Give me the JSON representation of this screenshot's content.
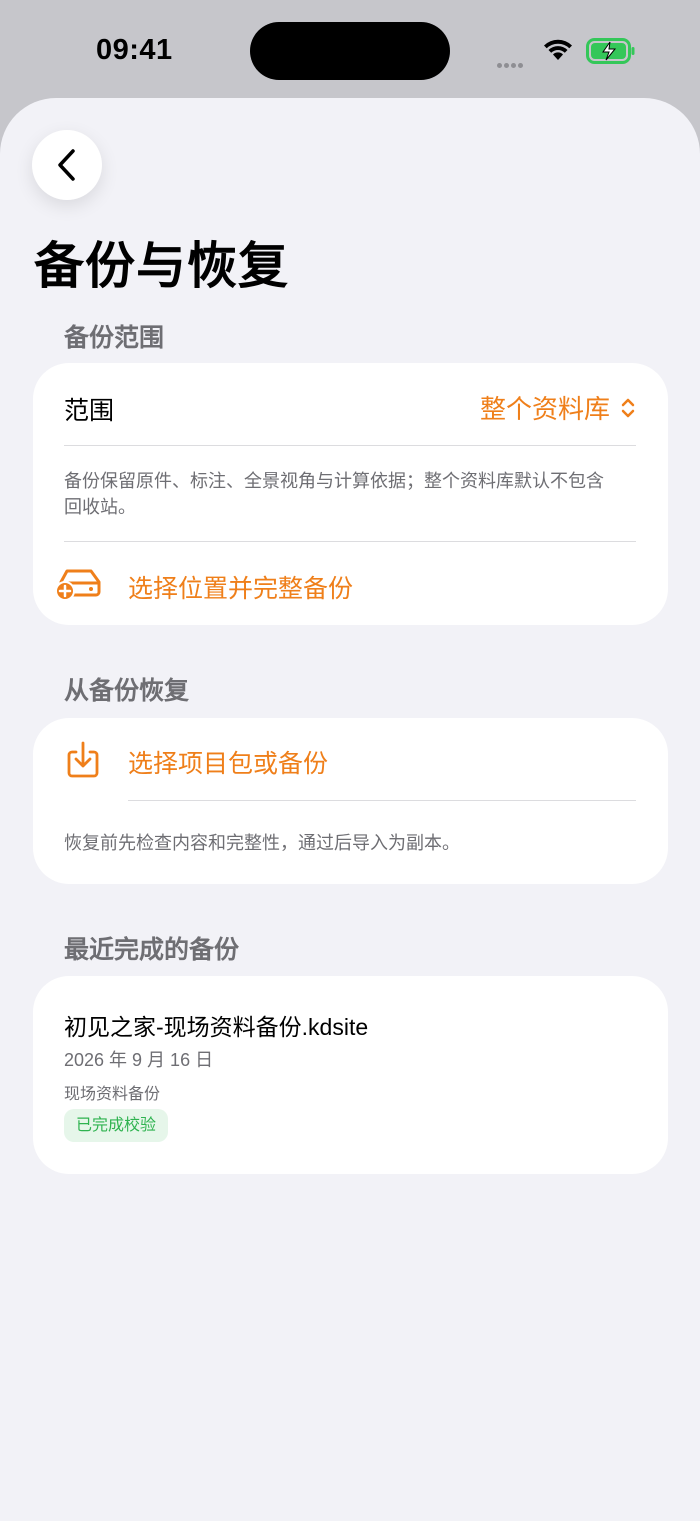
{
  "status_bar": {
    "time": "09:41"
  },
  "page": {
    "title": "备份与恢复"
  },
  "backup_scope": {
    "header": "备份范围",
    "scope_label": "范围",
    "scope_value": "整个资料库",
    "description": "备份保留原件、标注、全景视角与计算依据；整个资料库默认不包含回收站。",
    "action_label": "选择位置并完整备份"
  },
  "restore": {
    "header": "从备份恢复",
    "action_label": "选择项目包或备份",
    "description": "恢复前先检查内容和完整性，通过后导入为副本。"
  },
  "recent": {
    "header": "最近完成的备份",
    "items": [
      {
        "name": "初见之家-现场资料备份.kdsite",
        "date": "2026 年 9 月 16 日",
        "type": "现场资料备份",
        "status": "已完成校验"
      }
    ]
  },
  "colors": {
    "accent": "#ef7f1a",
    "success": "#2fb350",
    "background": "#f2f2f7"
  },
  "icons": [
    "back-chevron-icon",
    "up-down-chevron-icon",
    "drive-add-icon",
    "download-tray-icon",
    "wifi-icon",
    "battery-charging-icon"
  ]
}
